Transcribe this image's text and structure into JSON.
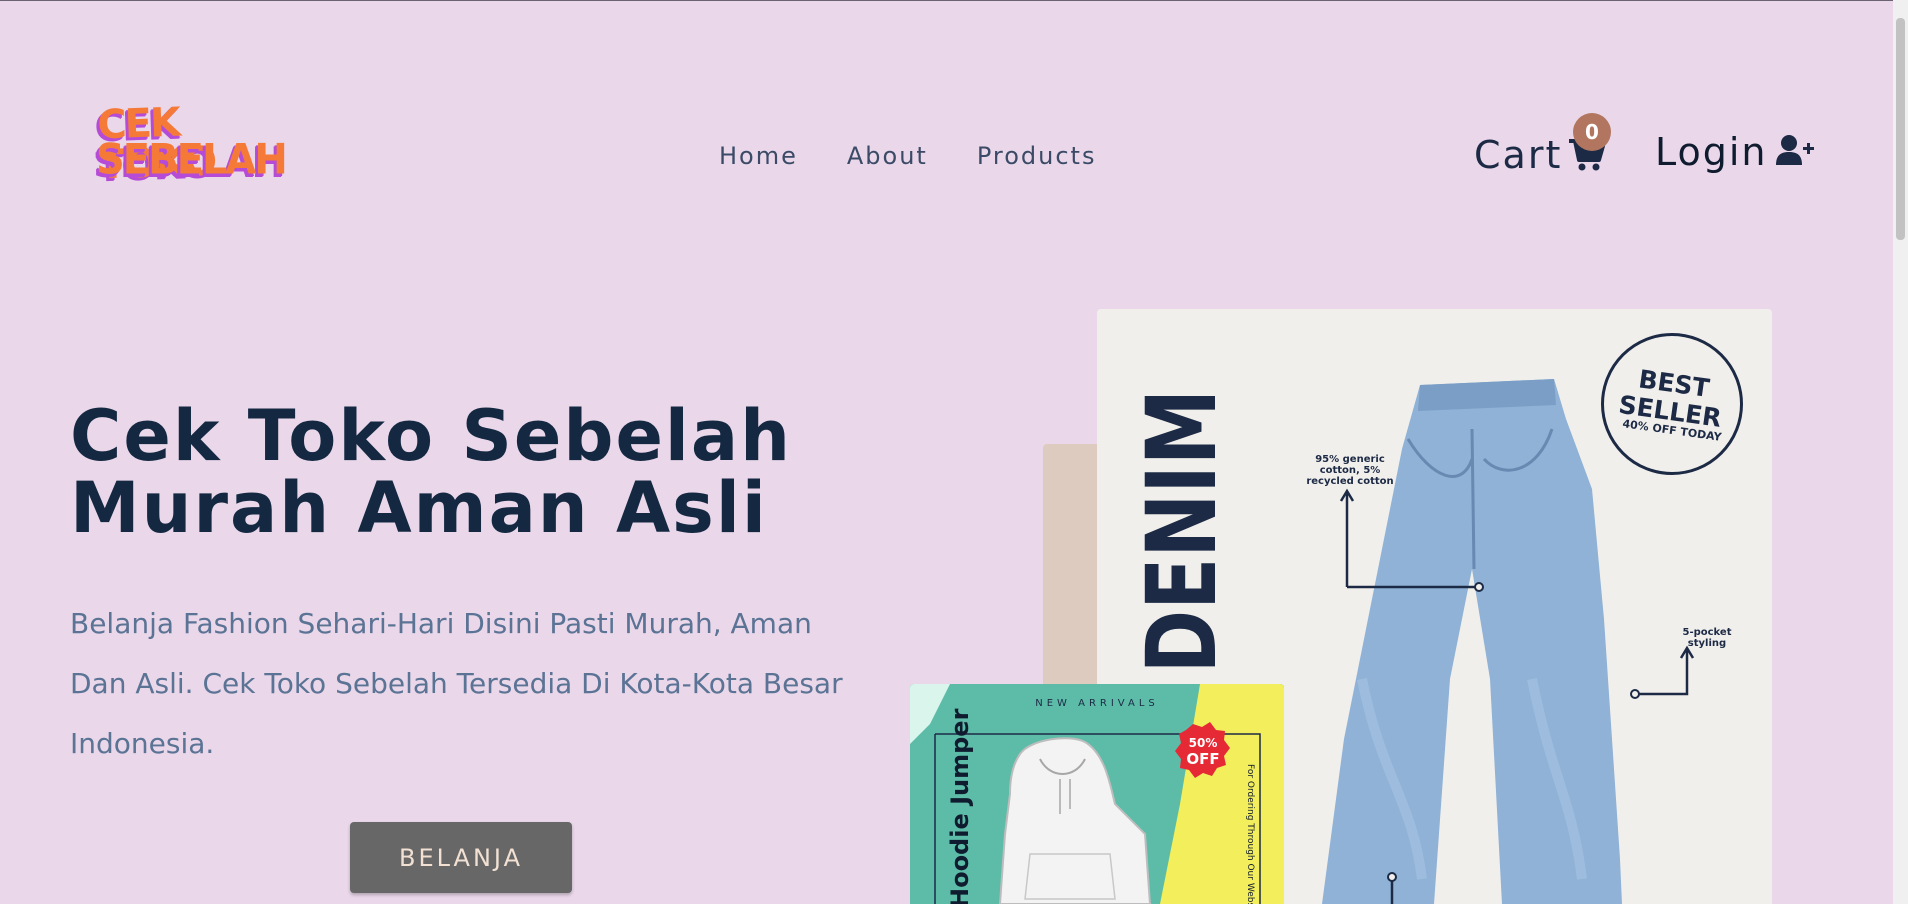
{
  "logo": {
    "line1": "CEK TOKO",
    "line2": "SEBELAH"
  },
  "nav": {
    "home": "Home",
    "about": "About",
    "products": "Products"
  },
  "cart": {
    "label": "Cart",
    "count": "0"
  },
  "login": {
    "label": "Login"
  },
  "hero": {
    "title_line1": "Cek Toko Sebelah",
    "title_line2": "Murah Aman Asli",
    "description": "Belanja Fashion Sehari-Hari Disini Pasti Murah, Aman Dan Asli. Cek Toko Sebelah Tersedia Di Kota-Kota Besar Indonesia.",
    "button": "BELANJA"
  },
  "denim_ad": {
    "title": "ON DENIM",
    "badge_line1": "BEST",
    "badge_line2": "SELLER",
    "badge_sub": "40% OFF TODAY",
    "annotation_1": "95% generic cotton, 5% recycled cotton",
    "annotation_2": "5-pocket styling"
  },
  "jumper_ad": {
    "header": "NEW ARRIVALS",
    "title": "Hoodie Jumper",
    "discount_pct": "50%",
    "discount_label": "OFF",
    "side_text": "For Ordering Through Our Website"
  },
  "colors": {
    "background": "#ead8ea",
    "heading": "#142842",
    "body_text": "#5b7394",
    "logo_orange": "#f57a38",
    "cart_badge": "#b27660",
    "button": "#676767"
  }
}
